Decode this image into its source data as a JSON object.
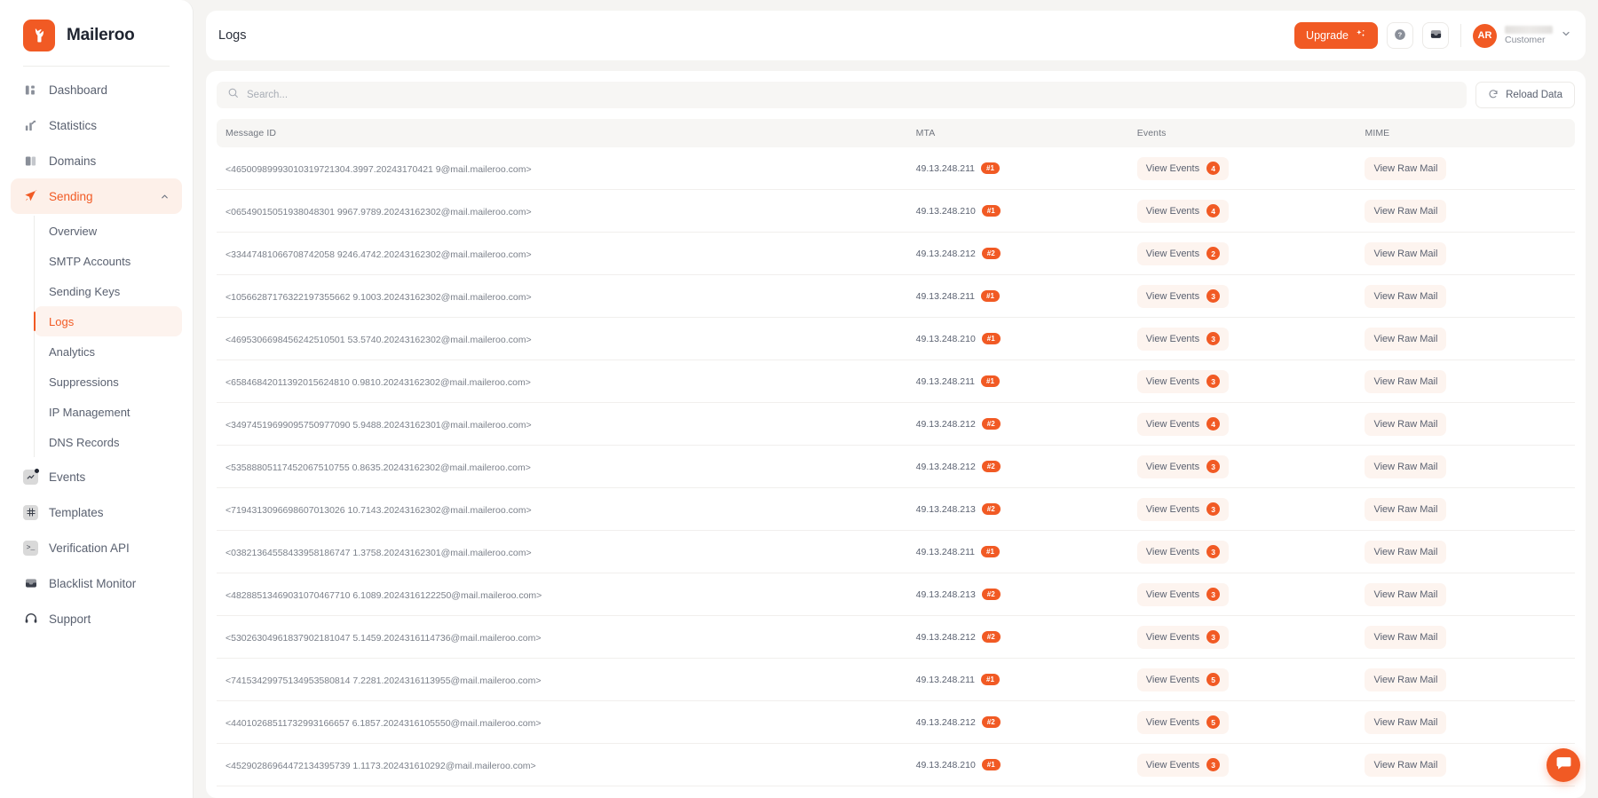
{
  "brand": {
    "name": "Maileroo",
    "logo_icon": "maileroo-fox-logo",
    "accent": "#f15a24"
  },
  "sidebar": {
    "items": [
      {
        "label": "Dashboard",
        "icon": "dashboard-icon",
        "active": false
      },
      {
        "label": "Statistics",
        "icon": "statistics-chart-icon",
        "active": false
      },
      {
        "label": "Domains",
        "icon": "domains-icon",
        "active": false
      },
      {
        "label": "Sending",
        "icon": "send-paperplane-icon",
        "active": true,
        "expanded": true
      },
      {
        "label": "Events",
        "icon": "events-icon",
        "active": false,
        "has_dot": true
      },
      {
        "label": "Templates",
        "icon": "templates-grid-icon",
        "active": false
      },
      {
        "label": "Verification API",
        "icon": "terminal-icon",
        "active": false
      },
      {
        "label": "Blacklist Monitor",
        "icon": "blacklist-monitor-icon",
        "active": false
      },
      {
        "label": "Support",
        "icon": "headset-icon",
        "active": false
      }
    ],
    "sending_subitems": [
      {
        "label": "Overview",
        "active": false
      },
      {
        "label": "SMTP Accounts",
        "active": false
      },
      {
        "label": "Sending Keys",
        "active": false
      },
      {
        "label": "Logs",
        "active": true
      },
      {
        "label": "Analytics",
        "active": false
      },
      {
        "label": "Suppressions",
        "active": false
      },
      {
        "label": "IP Management",
        "active": false
      },
      {
        "label": "DNS Records",
        "active": false
      }
    ]
  },
  "header": {
    "title": "Logs",
    "upgrade_label": "Upgrade",
    "upgrade_icon": "sparkles-icon",
    "help_icon": "question-mark-circle-icon",
    "inbox_icon": "inbox-icon",
    "avatar_initials": "AR",
    "user_role": "Customer",
    "chevron_icon": "chevron-down-icon"
  },
  "toolbar": {
    "search_placeholder": "Search...",
    "search_value": "",
    "search_icon": "search-icon",
    "reload_label": "Reload Data",
    "reload_icon": "refresh-icon"
  },
  "table": {
    "columns": [
      "Message ID",
      "MTA",
      "Events",
      "MIME"
    ],
    "events_label": "View Events",
    "mime_label": "View Raw Mail",
    "rows": [
      {
        "message_id": "<46500989993010319721304.3997.20243170421 9@mail.maileroo.com>",
        "mta_ip": "49.13.248.211",
        "mta_tag": "#1",
        "events": 4,
        "mime": "View Raw Mail"
      },
      {
        "message_id": "<06549015051938048301 9967.9789.20243162302@mail.maileroo.com>",
        "mta_ip": "49.13.248.210",
        "mta_tag": "#1",
        "events": 4,
        "mime": "View Raw Mail"
      },
      {
        "message_id": "<33447481066708742058 9246.4742.20243162302@mail.maileroo.com>",
        "mta_ip": "49.13.248.212",
        "mta_tag": "#2",
        "events": 2,
        "mime": "View Raw Mail"
      },
      {
        "message_id": "<10566287176322197355662 9.1003.20243162302@mail.maileroo.com>",
        "mta_ip": "49.13.248.211",
        "mta_tag": "#1",
        "events": 3,
        "mime": "View Raw Mail"
      },
      {
        "message_id": "<4695306698456242510501 53.5740.20243162302@mail.maileroo.com>",
        "mta_ip": "49.13.248.210",
        "mta_tag": "#1",
        "events": 3,
        "mime": "View Raw Mail"
      },
      {
        "message_id": "<65846842011392015624810 0.9810.20243162302@mail.maileroo.com>",
        "mta_ip": "49.13.248.211",
        "mta_tag": "#1",
        "events": 3,
        "mime": "View Raw Mail"
      },
      {
        "message_id": "<34974519699095750977090 5.9488.20243162301@mail.maileroo.com>",
        "mta_ip": "49.13.248.212",
        "mta_tag": "#2",
        "events": 4,
        "mime": "View Raw Mail"
      },
      {
        "message_id": "<53588805117452067510755 0.8635.20243162302@mail.maileroo.com>",
        "mta_ip": "49.13.248.212",
        "mta_tag": "#2",
        "events": 3,
        "mime": "View Raw Mail"
      },
      {
        "message_id": "<7194313096698607013026 10.7143.20243162302@mail.maileroo.com>",
        "mta_ip": "49.13.248.213",
        "mta_tag": "#2",
        "events": 3,
        "mime": "View Raw Mail"
      },
      {
        "message_id": "<03821364558433958186747 1.3758.20243162301@mail.maileroo.com>",
        "mta_ip": "49.13.248.211",
        "mta_tag": "#1",
        "events": 3,
        "mime": "View Raw Mail"
      },
      {
        "message_id": "<48288513469031070467710 6.1089.2024316122250@mail.maileroo.com>",
        "mta_ip": "49.13.248.213",
        "mta_tag": "#2",
        "events": 3,
        "mime": "View Raw Mail"
      },
      {
        "message_id": "<53026304961837902181047 5.1459.2024316114736@mail.maileroo.com>",
        "mta_ip": "49.13.248.212",
        "mta_tag": "#2",
        "events": 3,
        "mime": "View Raw Mail"
      },
      {
        "message_id": "<74153429975134953580814 7.2281.2024316113955@mail.maileroo.com>",
        "mta_ip": "49.13.248.211",
        "mta_tag": "#1",
        "events": 5,
        "mime": "View Raw Mail"
      },
      {
        "message_id": "<44010268511732993166657 6.1857.2024316105550@mail.maileroo.com>",
        "mta_ip": "49.13.248.212",
        "mta_tag": "#2",
        "events": 5,
        "mime": "View Raw Mail"
      },
      {
        "message_id": "<45290286964472134395739 1.1173.202431610292@mail.maileroo.com>",
        "mta_ip": "49.13.248.210",
        "mta_tag": "#1",
        "events": 3,
        "mime": "View Raw Mail"
      }
    ]
  },
  "chat": {
    "icon": "chat-bubble-icon"
  }
}
